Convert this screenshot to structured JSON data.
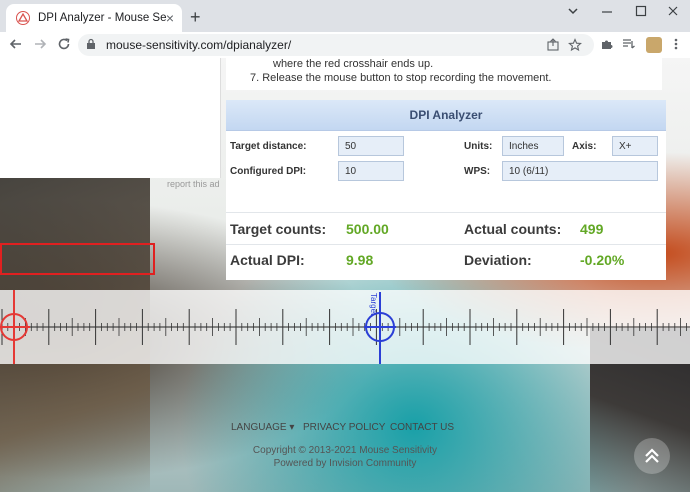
{
  "browser": {
    "tab_title": "DPI Analyzer - Mouse Sensitivity",
    "tab_close": "×",
    "new_tab": "+",
    "url": "mouse-sensitivity.com/dpianalyzer/"
  },
  "instructions": {
    "line1": "where the red crosshair ends up.",
    "line2": "7. Release the mouse button to stop recording the movement."
  },
  "ad": {
    "report_label": "report this ad"
  },
  "analyzer": {
    "title": "DPI Analyzer",
    "target_distance_label": "Target distance:",
    "target_distance_value": "50",
    "configured_dpi_label": "Configured DPI:",
    "configured_dpi_value": "10",
    "units_label": "Units:",
    "units_value": "Inches",
    "axis_label": "Axis:",
    "axis_value": "X+",
    "wps_label": "WPS:",
    "wps_value": "10 (6/11)",
    "target_counts_label": "Target counts:",
    "target_counts_value": "500.00",
    "actual_counts_label": "Actual counts:",
    "actual_counts_value": "499",
    "actual_dpi_label": "Actual DPI:",
    "actual_dpi_value": "9.98",
    "deviation_label": "Deviation:",
    "deviation_value": "-0.20%"
  },
  "ruler": {
    "target_label": "Target"
  },
  "footer": {
    "language": "LANGUAGE ▾",
    "privacy": "PRIVACY POLICY",
    "contact": "CONTACT US",
    "copyright": "Copyright © 2013-2021 Mouse Sensitivity",
    "powered": "Powered by Invision Community"
  },
  "colors": {
    "accent_green": "#62a825",
    "highlight_red": "#e02020",
    "start_crosshair": "#e53935",
    "target_crosshair": "#2b3fd6"
  }
}
